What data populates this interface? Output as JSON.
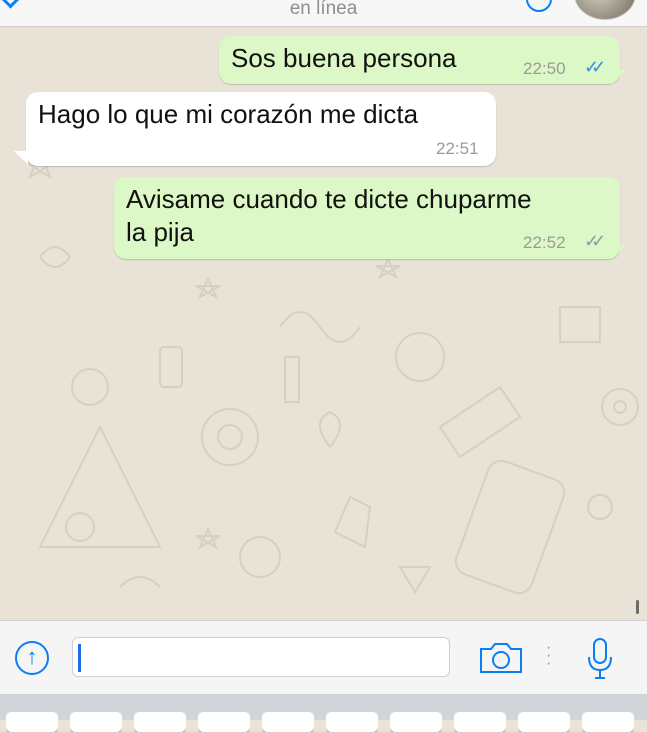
{
  "header": {
    "status": "en línea"
  },
  "messages": [
    {
      "direction": "out",
      "text": "Sos buena persona",
      "time": "22:50",
      "ticks": "read"
    },
    {
      "direction": "in",
      "text": "Hago lo que mi corazón me dicta",
      "time": "22:51"
    },
    {
      "direction": "out",
      "text": "Avisame cuando te dicte chuparme\nla pija",
      "time": "22:52",
      "ticks": "delivered"
    }
  ],
  "composer": {
    "value": "",
    "placeholder": ""
  },
  "icons": {
    "attach": "arrow-up-circle-icon",
    "camera": "camera-icon",
    "mic": "microphone-icon",
    "back": "chevron-left-icon"
  },
  "colors": {
    "outgoing_bubble": "#dcf8c6",
    "incoming_bubble": "#ffffff",
    "accent": "#0a7ef5",
    "read_ticks": "#3b8de0",
    "chat_background": "#e8e3d6"
  }
}
